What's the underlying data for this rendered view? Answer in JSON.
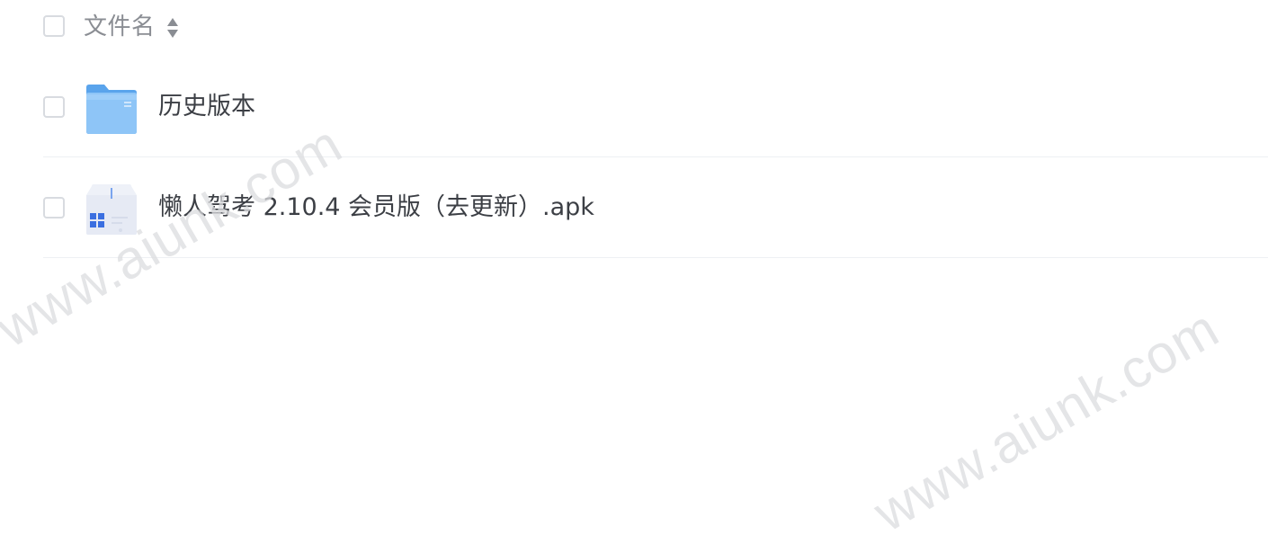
{
  "header": {
    "column_label": "文件名",
    "sort_icon": "sort-updown-icon"
  },
  "files": [
    {
      "name": "历史版本",
      "type": "folder",
      "icon": "folder-icon"
    },
    {
      "name": "懒人驾考 2.10.4 会员版（去更新）.apk",
      "type": "apk",
      "icon": "apk-file-icon"
    }
  ],
  "watermarks": [
    "www.aiunk.com",
    "www.aiunk.com"
  ],
  "colors": {
    "folder_blue": "#6fb2f2",
    "apk_accent": "#3b7be8",
    "text": "#3c3f45",
    "header_text": "#8a8d93",
    "border": "#d8dbe0",
    "divider": "#eef0f3"
  }
}
